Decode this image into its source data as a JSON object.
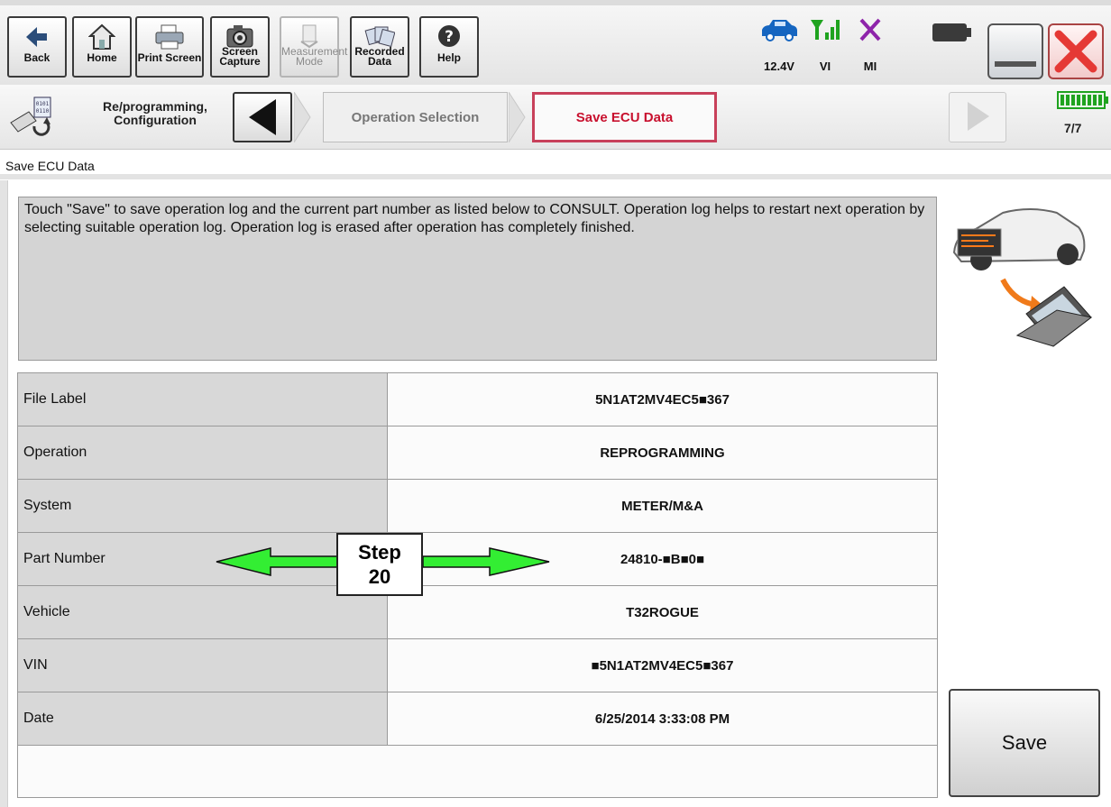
{
  "toolbar": {
    "back": "Back",
    "home": "Home",
    "print_screen": "Print Screen",
    "screen_capture": "Screen Capture",
    "measurement_mode": "Measurement Mode",
    "recorded_data": "Recorded Data",
    "help": "Help",
    "voltage": "12.4V",
    "vi": "VI",
    "mi": "MI"
  },
  "nav": {
    "mode_label": "Re/programming, Configuration",
    "step_operation_selection": "Operation Selection",
    "step_save_ecu_data": "Save ECU Data",
    "page_count": "7/7"
  },
  "page": {
    "title": "Save ECU Data",
    "message": "Touch \"Save\" to save operation log and the current part number as listed below to CONSULT. Operation log helps to restart next operation by selecting suitable operation log. Operation log is erased after operation has completely finished."
  },
  "table": {
    "rows": [
      {
        "label": "File Label",
        "value": "5N1AT2MV4EC5■367"
      },
      {
        "label": "Operation",
        "value": "REPROGRAMMING"
      },
      {
        "label": "System",
        "value": "METER/M&A"
      },
      {
        "label": "Part Number",
        "value": "24810-■B■0■"
      },
      {
        "label": "Vehicle",
        "value": "T32ROGUE"
      },
      {
        "label": "VIN",
        "value": "■5N1AT2MV4EC5■367"
      },
      {
        "label": "Date",
        "value": "6/25/2014 3:33:08 PM"
      }
    ]
  },
  "annotation": {
    "line1": "Step",
    "line2": "20"
  },
  "save_button": "Save",
  "colors": {
    "active_step": "#c8102e",
    "battery_green": "#1fa31f",
    "arrow_green": "#33ee33",
    "car_blue": "#1565c0",
    "close_red": "#e53935",
    "mi_purple": "#8e24aa"
  }
}
